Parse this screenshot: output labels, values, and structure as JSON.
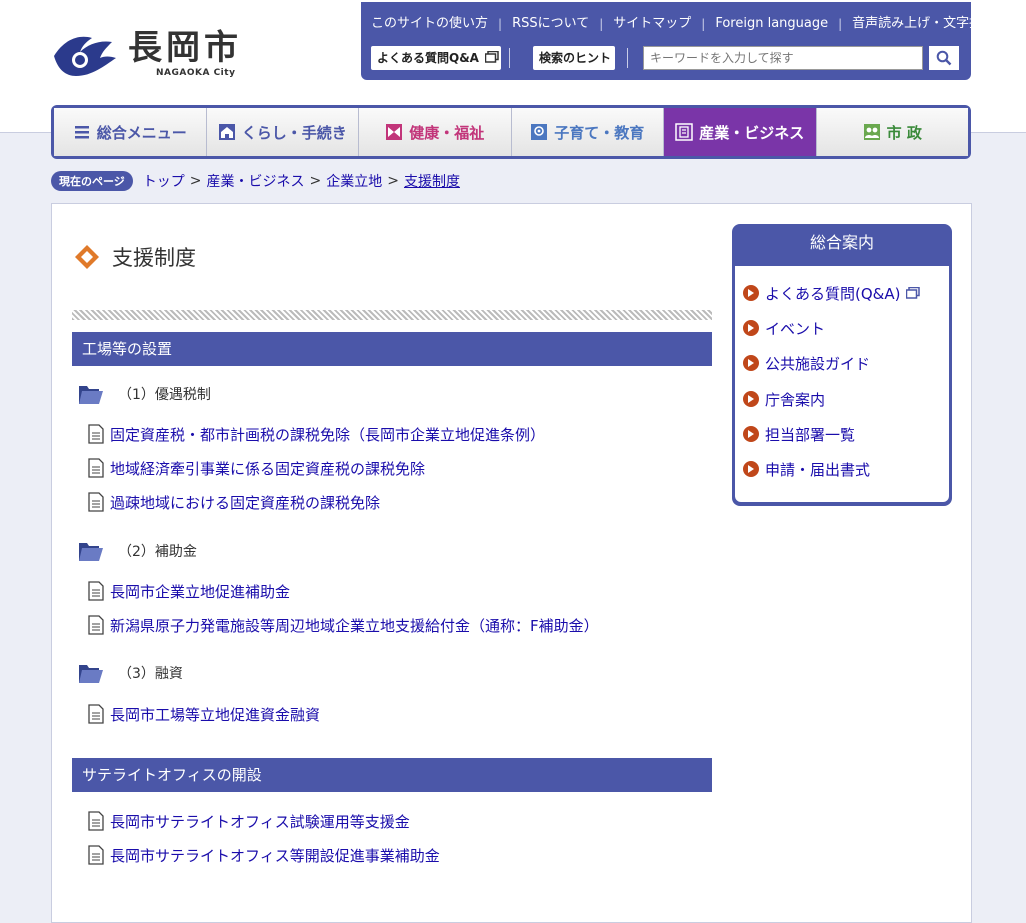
{
  "site": {
    "logo_text": "長岡市",
    "logo_sub": "NAGAOKA City"
  },
  "header": {
    "util_links": [
      "このサイトの使い方",
      "RSSについて",
      "サイトマップ",
      "Foreign language",
      "音声読み上げ・文字拡大等"
    ],
    "faq_chip": "よくある質問Q&A",
    "search_hint_chip": "検索のヒント",
    "search_placeholder": "キーワードを入力して探す"
  },
  "nav": {
    "items": [
      {
        "label": "総合メニュー",
        "icon": "menu-icon",
        "color": "#4b57a8"
      },
      {
        "label": "くらし・手続き",
        "icon": "house-icon",
        "color": "#4b57a8"
      },
      {
        "label": "健康・福祉",
        "icon": "health-icon",
        "color": "#c2357a"
      },
      {
        "label": "子育て・教育",
        "icon": "kids-icon",
        "color": "#4b77c0"
      },
      {
        "label": "産業・ビジネス",
        "icon": "building-icon",
        "color": "#ffffff"
      },
      {
        "label": "市 政",
        "icon": "people-icon",
        "color": "#3a8a3a"
      }
    ]
  },
  "breadcrumb": {
    "badge": "現在のページ",
    "items": [
      "トップ",
      "産業・ビジネス",
      "企業立地"
    ],
    "current": "支援制度"
  },
  "main": {
    "title": "支援制度",
    "sections": [
      {
        "heading": "工場等の設置",
        "groups": [
          {
            "label": "（1）優遇税制",
            "links": [
              "固定資産税・都市計画税の課税免除（長岡市企業立地促進条例）",
              "地域経済牽引事業に係る固定資産税の課税免除",
              "過疎地域における固定資産税の課税免除"
            ]
          },
          {
            "label": "（2）補助金",
            "links": [
              "長岡市企業立地促進補助金",
              "新潟県原子力発電施設等周辺地域企業立地支援給付金（通称：F補助金）"
            ]
          },
          {
            "label": "（3）融資",
            "links": [
              "長岡市工場等立地促進資金融資"
            ]
          }
        ]
      },
      {
        "heading": "サテライトオフィスの開設",
        "links": [
          "長岡市サテライトオフィス試験運用等支援金",
          "長岡市サテライトオフィス等開設促進事業補助金"
        ]
      }
    ]
  },
  "sidebar": {
    "title": "総合案内",
    "items": [
      "よくある質問(Q&A)",
      "イベント",
      "公共施設ガイド",
      "庁舎案内",
      "担当部署一覧",
      "申請・届出書式"
    ]
  },
  "colors": {
    "brand": "#4b57a8",
    "active_nav": "#7a35a8",
    "accent_orange": "#e07a2a",
    "link": "#1a0dab"
  }
}
